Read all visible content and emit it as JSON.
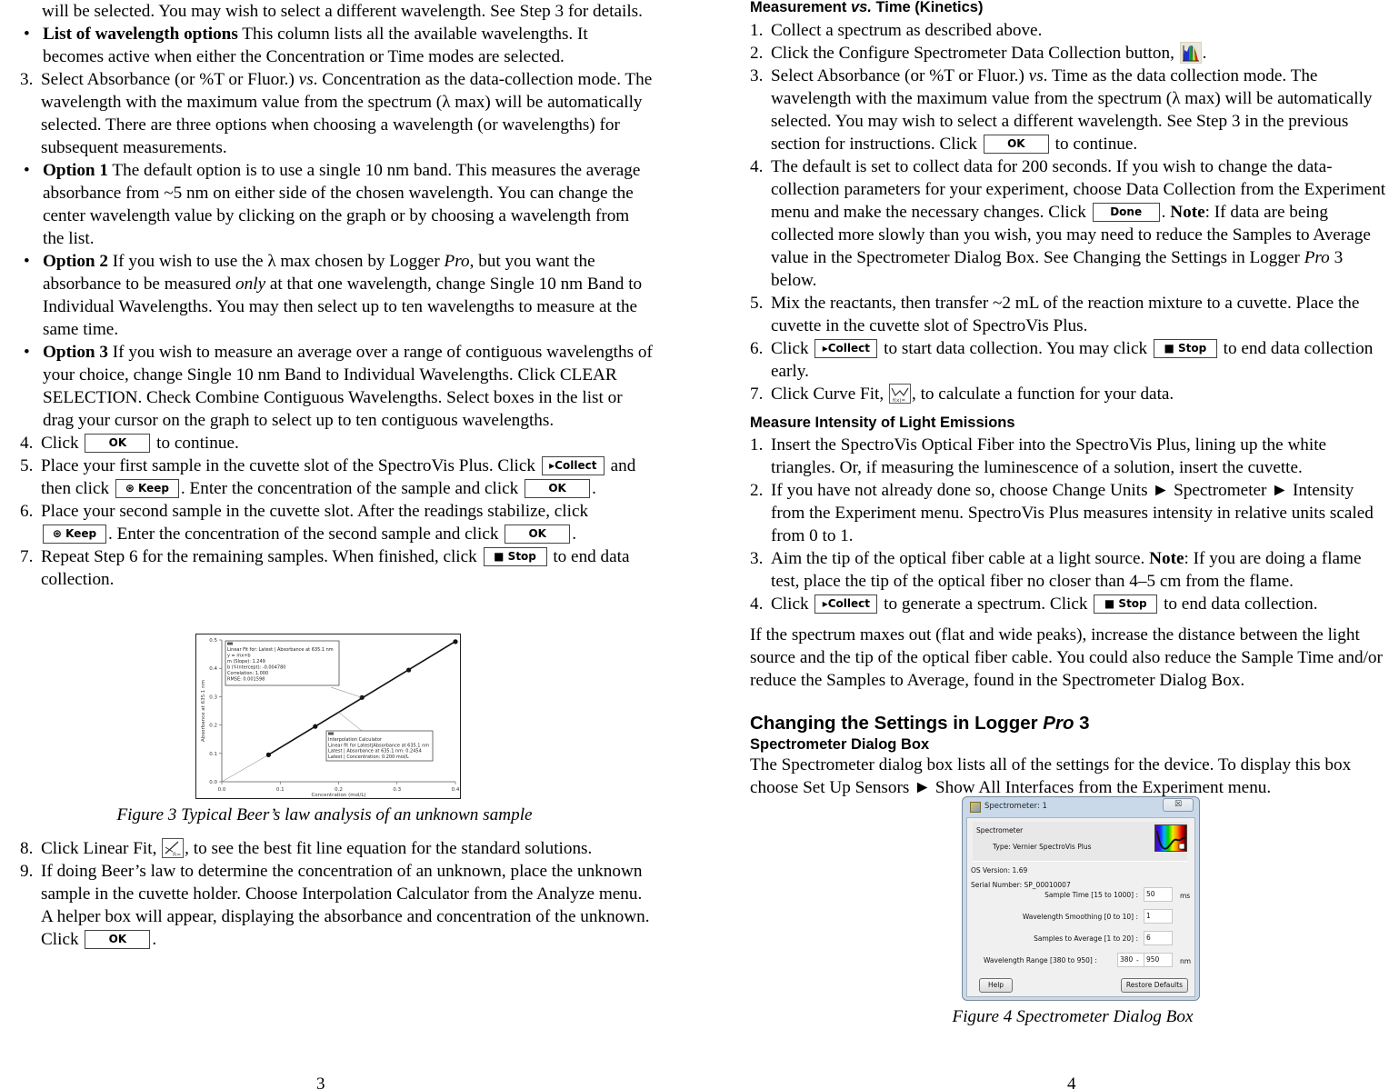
{
  "left_page": {
    "page_number": "3",
    "intro_cont": "will be selected. You may wish to select a different wavelength. See Step 3 for details.",
    "bullet_list_options": {
      "bold": "List of wavelength options",
      "text": "  This column lists all the available wavelengths. It becomes active when either the Concentration or Time modes are selected."
    },
    "step3": {
      "num": "3.",
      "pre": "Select Absorbance (or %T or Fluor.) ",
      "vs": "vs",
      "post": ". Concentration as the data-collection mode. The wavelength with the maximum value from the spectrum (λ max) will be automatically selected. There are three options when choosing a wavelength (or wavelengths) for subsequent measurements."
    },
    "option1": {
      "bold": "Option 1",
      "text": "  The default option is to use a single 10 nm band. This measures the average absorbance from ~5 nm on either side of the chosen wavelength. You can change the center wavelength value by clicking on the graph or by choosing a wavelength from the list."
    },
    "option2": {
      "bold": "Option 2",
      "pre": "  If you wish to use the λ max chosen by Logger ",
      "pro": "Pro",
      "mid": ", but you want the absorbance to be measured ",
      "only": "only",
      "post": " at that one wavelength, change Single 10 nm Band to Individual Wavelengths. You may then select up to ten wavelengths to measure at the same time."
    },
    "option3": {
      "bold": "Option 3",
      "text": "  If you wish to measure an average over a range of contiguous wavelengths of your choice, change Single 10 nm Band to Individual Wavelengths. Click CLEAR SELECTION. Check Combine Contiguous Wavelengths. Select boxes in the list or drag your cursor on the graph to select up to ten contiguous wavelengths."
    },
    "step4": {
      "num": "4.",
      "pre": "Click ",
      "post": " to continue."
    },
    "step5": {
      "num": "5.",
      "pre": "Place your first sample in the cuvette slot of the SpectroVis Plus. Click ",
      "mid": " and then click ",
      "mid2": ". Enter the concentration of the sample and click ",
      "post": "."
    },
    "step6": {
      "num": "6.",
      "pre": "Place your second sample in the cuvette slot. After the readings stabilize, click ",
      "mid": ". Enter the concentration of the second sample and click ",
      "post": "."
    },
    "step7": {
      "num": "7.",
      "pre": "Repeat Step 6 for the remaining samples. When finished, click ",
      "post": " to end data collection."
    },
    "figure3_caption": "Figure 3  Typical Beer’s law analysis of an unknown sample",
    "step8": {
      "num": "8.",
      "pre": "Click Linear Fit, ",
      "post": ", to see the best fit line equation for the standard solutions."
    },
    "step9": {
      "num": "9.",
      "pre": "If doing Beer’s law to determine the concentration of an unknown, place the unknown sample in the cuvette holder. Choose Interpolation Calculator from the Analyze menu. A helper box will appear, displaying the absorbance and concentration of the unknown. Click ",
      "post": "."
    }
  },
  "right_page": {
    "page_number": "4",
    "kinetics_heading": {
      "pre": "Measurement ",
      "vs": "vs.",
      "post": " Time (Kinetics)"
    },
    "k1": {
      "num": "1.",
      "text": "Collect a spectrum as described above."
    },
    "k2": {
      "num": "2.",
      "pre": "Click the Configure Spectrometer Data Collection button, ",
      "post": "."
    },
    "k3": {
      "num": "3.",
      "pre": "Select Absorbance (or %T or Fluor.) ",
      "vs": "vs",
      "post": ". Time as the data collection mode. The wavelength with the maximum value from the spectrum (λ max) will be automatically selected. You may wish to select a different wavelength. See Step 3 in the previous section for instructions. Click ",
      "post2": " to continue."
    },
    "k4": {
      "num": "4.",
      "pre": "The default is set to collect data for 200 seconds. If you wish to change the data-collection parameters for your experiment, choose Data Collection from the Experiment menu and make the necessary changes. Click ",
      "mid": ". ",
      "note": "Note",
      "post": ": If data are being collected more slowly than you wish, you may need to reduce the Samples to Average value in the Spectrometer Dialog Box. See Changing the Settings in Logger ",
      "pro": "Pro",
      "post2": " 3 below."
    },
    "k5": {
      "num": "5.",
      "text": "Mix the reactants, then transfer ~2 mL of the reaction mixture to a cuvette. Place the cuvette in the cuvette slot of SpectroVis Plus."
    },
    "k6": {
      "num": "6.",
      "pre": "Click ",
      "mid": " to start data collection. You may click ",
      "post": " to end data collection early."
    },
    "k7": {
      "num": "7.",
      "pre": "Click Curve Fit, ",
      "post": ", to calculate a function for your data."
    },
    "emissions_heading": "Measure Intensity of Light Emissions",
    "e1": {
      "num": "1.",
      "text": "Insert the SpectroVis Optical Fiber into the SpectroVis Plus, lining up the white triangles. Or, if measuring the luminescence of a solution, insert the cuvette."
    },
    "e2": {
      "num": "2.",
      "text": "If you have not already done so, choose Change Units ► Spectrometer ► Intensity from the Experiment menu. SpectroVis Plus measures intensity in relative units scaled from 0 to 1."
    },
    "e3": {
      "num": "3.",
      "pre": "Aim the tip of the optical fiber cable at a light source. ",
      "note": "Note",
      "post": ": If you are doing a flame test, place the tip of the optical fiber no closer than 4–5 cm from the flame."
    },
    "e4": {
      "num": "4.",
      "pre": "Click ",
      "mid": " to generate a spectrum. Click ",
      "post": " to end data collection."
    },
    "maxes_para": "If the spectrum maxes out (flat and wide peaks), increase the distance between the light source and the tip of the optical fiber cable. You could also reduce the Sample Time and/or reduce the Samples to Average, found in the Spectrometer Dialog Box.",
    "settings_heading": {
      "pre": "Changing the Settings in Logger ",
      "pro": "Pro",
      "post": " 3"
    },
    "dialog_subheading": "Spectrometer Dialog Box",
    "dialog_para": "The Spectrometer dialog box lists all of the settings for the device. To display this box choose Set Up Sensors ► Show All Interfaces from the Experiment menu.",
    "figure4_caption": "Figure 4  Spectrometer Dialog Box"
  },
  "buttons": {
    "ok": "OK",
    "done": "Done",
    "collect": "Collect",
    "keep": "Keep",
    "stop": "Stop"
  },
  "dialog": {
    "title": "Spectrometer: 1",
    "close": "☒",
    "group_label": "Spectrometer",
    "type": "Type: Vernier SpectroVis Plus",
    "os_version": "OS Version: 1.69",
    "serial": "Serial Number: SP_00010007",
    "sample_time_label": "Sample Time [15 to 1000] :",
    "sample_time_value": "50",
    "sample_time_unit": "ms",
    "smoothing_label": "Wavelength Smoothing [0 to 10] :",
    "smoothing_value": "1",
    "average_label": "Samples to Average [1 to 20] :",
    "average_value": "6",
    "range_label": "Wavelength Range [380 to 950] :",
    "range_min": "380",
    "range_dash": "-",
    "range_max": "950",
    "range_unit": "nm",
    "help": "Help",
    "restore": "Restore Defaults"
  },
  "chart_data": {
    "type": "scatter",
    "title": "",
    "xlabel": "Concentration (mol/L)",
    "ylabel": "Absorbance at 635.1 nm",
    "xlim": [
      0.0,
      0.4
    ],
    "ylim": [
      0.0,
      0.5
    ],
    "xticks": [
      "0.0",
      "0.1",
      "0.2",
      "0.3",
      "0.4"
    ],
    "yticks": [
      "0.0",
      "0.1",
      "0.2",
      "0.3",
      "0.4",
      "0.5"
    ],
    "x": [
      0.08,
      0.16,
      0.24,
      0.32,
      0.4
    ],
    "y": [
      0.095,
      0.195,
      0.297,
      0.394,
      0.494
    ],
    "fit": {
      "slope": 1.249,
      "intercept": -0.00478
    },
    "fit_box": [
      "Linear Fit for: Latest | Absorbance at 635.1 nm",
      "y = mx+b",
      "m (Slope): 1.249",
      "b (Y-Intercept): -0.004780",
      "Correlation: 1.000",
      "RMSE: 0.001598"
    ],
    "interp_box": [
      "Interpolation Calculator",
      "Linear fit for Latest|Absorbance at 635.1 nm",
      "Latest | Absorbance at 635.1 nm: 0.2454",
      "Latest | Concentration: 0.200 mol/L"
    ],
    "interp_point": {
      "x": 0.2,
      "y": 0.2454
    }
  }
}
